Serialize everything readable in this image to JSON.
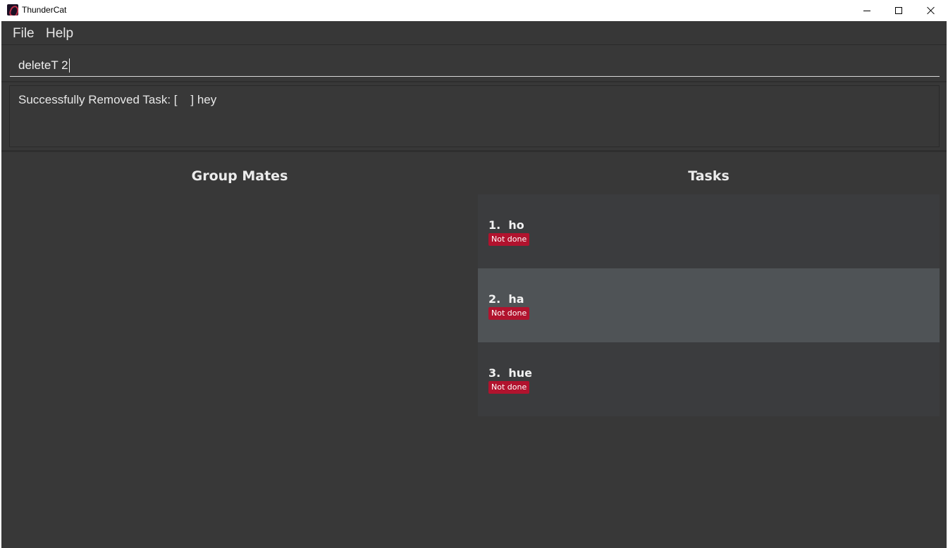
{
  "window": {
    "title": "ThunderCat",
    "icon": "thundercat-app-icon"
  },
  "menu": {
    "items": [
      {
        "label": "File"
      },
      {
        "label": "Help"
      }
    ]
  },
  "command": {
    "value": "deleteT 2"
  },
  "result": {
    "text": "Successfully Removed Task: [    ] hey"
  },
  "panels": {
    "group_mates_title": "Group Mates",
    "tasks_title": "Tasks"
  },
  "tasks": [
    {
      "index": "1.",
      "name": "ho",
      "status": "Not done",
      "selected": false
    },
    {
      "index": "2.",
      "name": "ha",
      "status": "Not done",
      "selected": true
    },
    {
      "index": "3.",
      "name": "hue",
      "status": "Not done",
      "selected": false
    }
  ],
  "colors": {
    "background": "#383838",
    "status_not_done": "#b1132e",
    "selected_row": "#4f5356"
  }
}
